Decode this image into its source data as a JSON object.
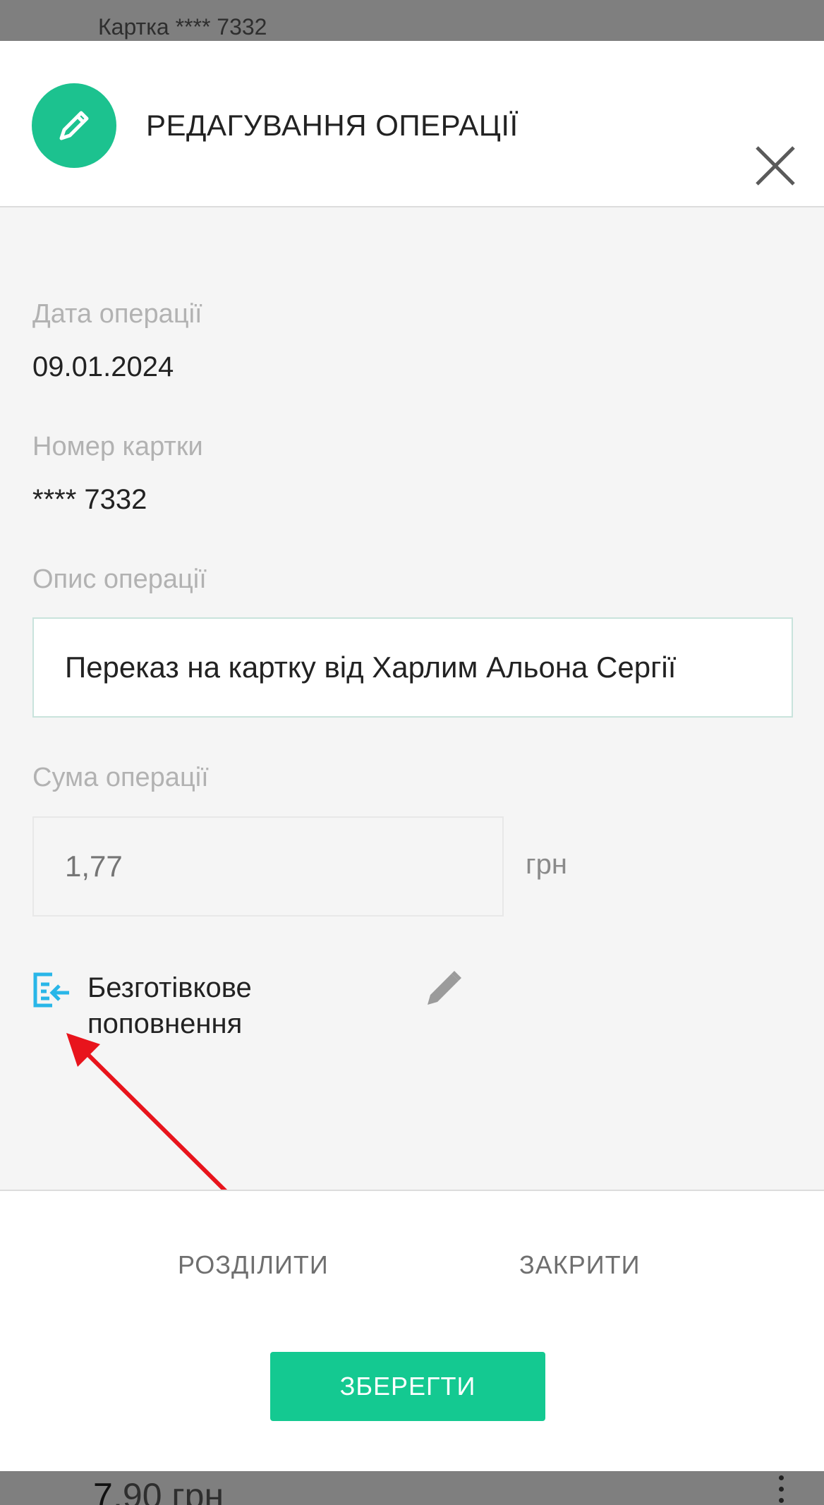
{
  "background": {
    "card_label": "Картка **** 7332",
    "amount_integer": "7",
    "amount_rest": ",90 грн"
  },
  "modal": {
    "title": "РЕДАГУВАННЯ ОПЕРАЦІЇ",
    "date": {
      "label": "Дата операції",
      "value": "09.01.2024"
    },
    "card": {
      "label": "Номер картки",
      "value": "**** 7332"
    },
    "description": {
      "label": "Опис операції",
      "value": "Переказ на картку від Харлим Альона Сергії"
    },
    "sum": {
      "label": "Сума операції",
      "placeholder": "1,77",
      "currency": "грн"
    },
    "category": {
      "line1": "Безготівкове",
      "line2": "поповнення",
      "icon": "list-arrow-in-icon"
    },
    "footer": {
      "split_label": "РОЗДІЛИТИ",
      "close_label": "ЗАКРИТИ",
      "save_label": "ЗБЕРЕГТИ"
    }
  },
  "colors": {
    "accent": "#1cc28f",
    "save_button": "#14c991",
    "category_icon": "#29b6e8",
    "annotation_arrow": "#e8141c"
  }
}
